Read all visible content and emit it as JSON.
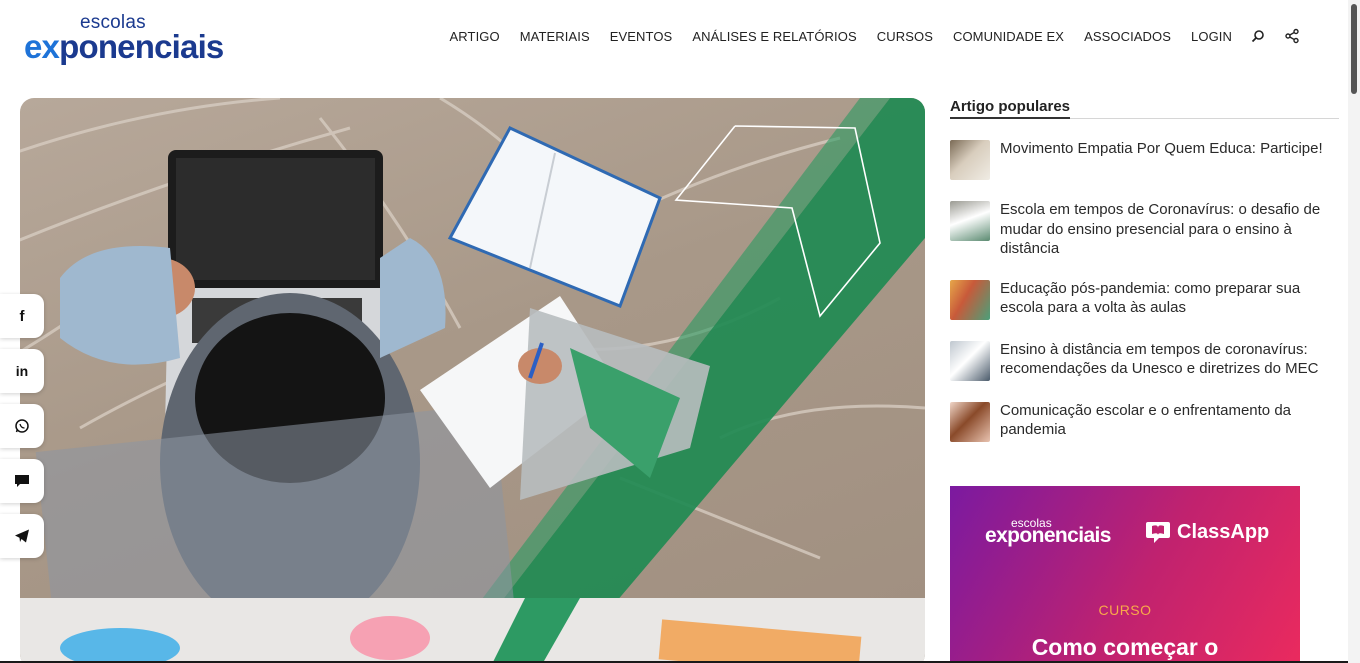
{
  "header": {
    "logo": {
      "small": "escolas",
      "big_prefix": "ex",
      "big_rest": "ponenciais"
    },
    "nav": [
      "ARTIGO",
      "MATERIAIS",
      "EVENTOS",
      "ANÁLISES E RELATÓRIOS",
      "CURSOS",
      "COMUNIDADE EX",
      "ASSOCIADOS",
      "LOGIN"
    ],
    "icons": [
      "search-icon",
      "share-icon"
    ]
  },
  "social": {
    "buttons": [
      {
        "name": "facebook-icon",
        "glyph": "f"
      },
      {
        "name": "linkedin-icon",
        "glyph": "in"
      },
      {
        "name": "whatsapp-icon",
        "glyph": ""
      },
      {
        "name": "comment-icon",
        "glyph": ""
      },
      {
        "name": "telegram-icon",
        "glyph": ""
      }
    ]
  },
  "sidebar": {
    "title": "Artigo populares",
    "items": [
      {
        "text": "Movimento Empatia Por Quem Educa: Participe!"
      },
      {
        "text": "Escola em tempos de Coronavírus: o desafio de mudar do ensino presencial para o ensino à distância"
      },
      {
        "text": "Educação pós-pandemia: como preparar sua escola para a volta às aulas"
      },
      {
        "text": "Ensino à distância em tempos de coronavírus: recomendações da Unesco e diretrizes do MEC"
      },
      {
        "text": "Comunicação escolar e o enfrentamento da pandemia"
      }
    ]
  },
  "ad": {
    "logo1_small": "escolas",
    "logo1_big": "exponenciais",
    "logo2": "ClassApp",
    "kicker": "CURSO",
    "headline": "Como começar o"
  },
  "colors": {
    "brand_blue": "#1b3a8f",
    "accent_green": "#2e8b57",
    "ad_pink": "#ea2a5e"
  }
}
